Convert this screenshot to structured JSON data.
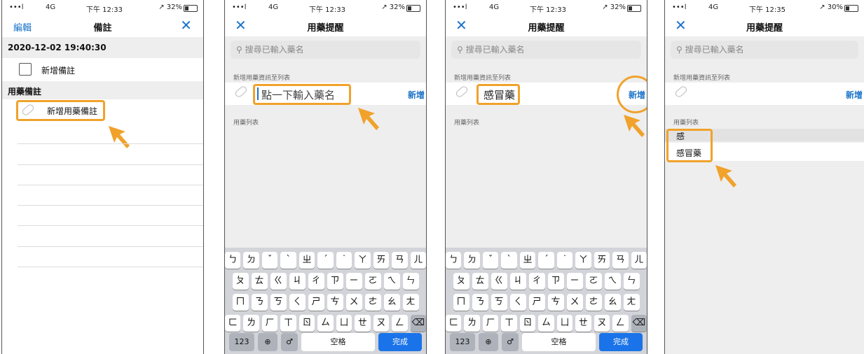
{
  "status": {
    "signal": "•••l",
    "network": "4G",
    "time1": "下午 12:33",
    "time4": "下午 12:35",
    "battery1": "↗ 32%",
    "battery4": "↗ 30%"
  },
  "screen1": {
    "left_label": "編輯",
    "title": "備註",
    "close": "✕",
    "date_header": "2020-12-02 19:40:30",
    "add_note": "新增備註",
    "section": "用藥備註",
    "add_med_note": "新增用藥備註"
  },
  "screen2": {
    "close": "✕",
    "title": "用藥提醒",
    "search_placeholder": "搜尋已輸入藥名",
    "add_section": "新增用藥資訊至列表",
    "input_placeholder": "點一下輸入藥名",
    "add_button": "新增",
    "list_section": "用藥列表"
  },
  "screen3": {
    "close": "✕",
    "title": "用藥提醒",
    "search_placeholder": "搜尋已輸入藥名",
    "add_section": "新增用藥資訊至列表",
    "input_value": "感冒藥",
    "add_button": "新增",
    "list_section": "用藥列表"
  },
  "screen4": {
    "close": "✕",
    "title": "用藥提醒",
    "search_placeholder": "搜尋已輸入藥名",
    "add_section": "新增用藥資訊至列表",
    "add_button": "新增",
    "list_section": "用藥列表",
    "items": [
      "感",
      "感冒藥"
    ]
  },
  "keyboard": {
    "row1": [
      "ㄅ",
      "ㄉ",
      "ˇ",
      "ˋ",
      "ㄓ",
      "ˊ",
      "˙",
      "ㄚ",
      "ㄞ",
      "ㄢ",
      "ㄦ"
    ],
    "row2": [
      "ㄆ",
      "ㄊ",
      "ㄍ",
      "ㄐ",
      "ㄔ",
      "ㄗ",
      "ㄧ",
      "ㄛ",
      "ㄟ",
      "ㄣ"
    ],
    "row3": [
      "ㄇ",
      "ㄋ",
      "ㄎ",
      "ㄑ",
      "ㄕ",
      "ㄘ",
      "ㄨ",
      "ㄜ",
      "ㄠ",
      "ㄤ"
    ],
    "row4": [
      "ㄈ",
      "ㄌ",
      "ㄏ",
      "ㄒ",
      "ㄖ",
      "ㄙ",
      "ㄩ",
      "ㄝ",
      "ㄡ",
      "ㄥ",
      "⌫"
    ],
    "num_key": "123",
    "globe_key": "⊕",
    "mic_key": "♂",
    "space_key": "空格",
    "done_key": "完成"
  },
  "colors": {
    "accent": "#1a73c8",
    "highlight": "#f0a22b",
    "done": "#1a73e8"
  }
}
